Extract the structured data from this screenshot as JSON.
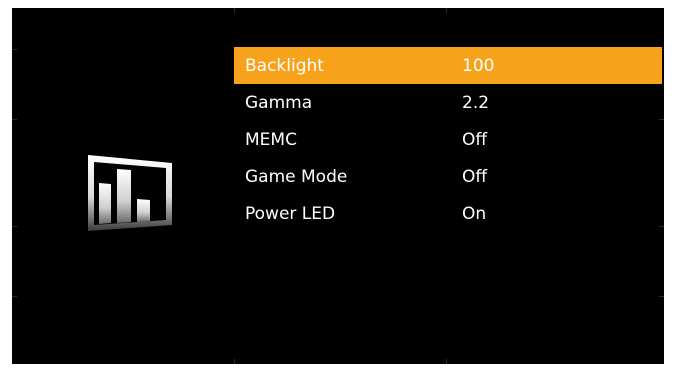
{
  "osd": {
    "category_icon": "bar-chart-display-icon",
    "accent_color": "#f7a21b",
    "background_color": "#000000",
    "selected_index": 0,
    "items": [
      {
        "label": "Backlight",
        "value": "100"
      },
      {
        "label": "Gamma",
        "value": "2.2"
      },
      {
        "label": "MEMC",
        "value": "Off"
      },
      {
        "label": "Game Mode",
        "value": "Off"
      },
      {
        "label": "Power LED",
        "value": "On"
      }
    ]
  }
}
